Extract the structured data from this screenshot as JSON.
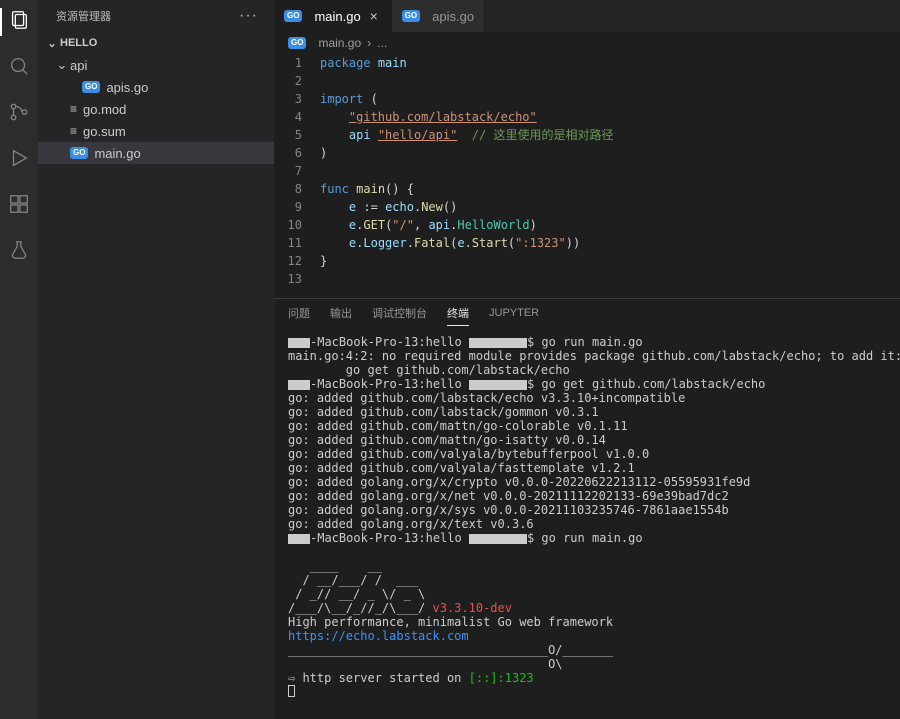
{
  "sidebar": {
    "title": "资源管理器",
    "project": "HELLO",
    "tree": {
      "folder_api": "api",
      "file_apis": "apis.go",
      "file_gomod": "go.mod",
      "file_gosum": "go.sum",
      "file_main": "main.go"
    }
  },
  "tabs": {
    "main": "main.go",
    "apis": "apis.go"
  },
  "breadcrumb": {
    "file": "main.go",
    "sep": "›",
    "more": "..."
  },
  "editor": {
    "lines": [
      "1",
      "2",
      "3",
      "4",
      "5",
      "6",
      "7",
      "8",
      "9",
      "10",
      "11",
      "12",
      "13"
    ],
    "t": {
      "package": "package",
      "main": "main",
      "import": "import",
      "lparen": "(",
      "rparen": ")",
      "echo_import": "\"github.com/labstack/echo\"",
      "api_ident": "api",
      "api_import": "\"hello/api\"",
      "api_comment": "// 这里使用的是相对路径",
      "func": "func",
      "main_fn": "main",
      "unit_parens": "()",
      "lbrace": "{",
      "rbrace": "}",
      "e": "e",
      "assign": ":=",
      "echo": "echo",
      "dot": ".",
      "New": "New",
      "GET": "GET",
      "slash": "\"/\"",
      "comma": ",",
      "api2": "api",
      "HelloWorld": "HelloWorld",
      "Logger": "Logger",
      "Fatal": "Fatal",
      "Start": "Start",
      "port": "\":1323\""
    }
  },
  "panel": {
    "tabs": {
      "problems": "问题",
      "output": "输出",
      "debug": "调试控制台",
      "terminal": "终端",
      "jupyter": "JUPYTER"
    }
  },
  "terminal": {
    "prompt_host": "-MacBook-Pro-13:hello ",
    "dollar": "$ ",
    "cmd_run": "go run main.go",
    "err_line": "main.go:4:2: no required module provides package github.com/labstack/echo; to add it:",
    "err_hint": "        go get github.com/labstack/echo",
    "cmd_get": "go get github.com/labstack/echo",
    "added": [
      "go: added github.com/labstack/echo v3.3.10+incompatible",
      "go: added github.com/labstack/gommon v0.3.1",
      "go: added github.com/mattn/go-colorable v0.1.11",
      "go: added github.com/mattn/go-isatty v0.0.14",
      "go: added github.com/valyala/bytebufferpool v1.0.0",
      "go: added github.com/valyala/fasttemplate v1.2.1",
      "go: added golang.org/x/crypto v0.0.0-20220622213112-05595931fe9d",
      "go: added golang.org/x/net v0.0.0-20211112202133-69e39bad7dc2",
      "go: added golang.org/x/sys v0.0.0-20211103235746-7861aae1554b",
      "go: added golang.org/x/text v0.3.6"
    ],
    "banner1": "   ____    __",
    "banner2": "  / __/___/ /  ___",
    "banner3": " / _// __/ _ \\/ _ \\",
    "banner4": "/___/\\__/_//_/\\___/ ",
    "version": "v3.3.10-dev",
    "tagline": "High performance, minimalist Go web framework",
    "site": "https://echo.labstack.com",
    "divider1": "____________________________________O/_______",
    "divider2": "                                    O\\",
    "started_prefix": "⇨ http server started on ",
    "started_addr": "[::]:1323"
  }
}
